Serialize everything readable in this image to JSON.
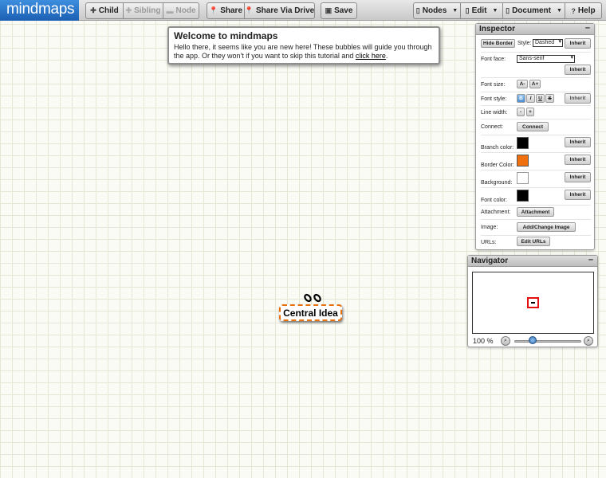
{
  "app": {
    "logo": "mindmaps"
  },
  "toolbar": {
    "child": "Child",
    "sibling": "Sibling",
    "node": "Node",
    "share": "Share",
    "share_drive": "Share Via Drive",
    "save": "Save",
    "nodes": "Nodes",
    "edit": "Edit",
    "document": "Document",
    "help": "Help"
  },
  "welcome": {
    "title": "Welcome to mindmaps",
    "text": "Hello there, it seems like you are new here! These bubbles will guide you through the app. Or they won't if you want to skip this tutorial and",
    "link": "click here",
    "end": "."
  },
  "inspector": {
    "title": "Inspector",
    "collapse": "–",
    "hide_border": "Hide Border",
    "style_label": "Style:",
    "style_value": "Dashed",
    "inherit": "Inherit",
    "font_face_label": "Font face:",
    "font_face_value": "Sans-serif",
    "font_size_label": "Font size:",
    "font_size_down": "A-",
    "font_size_up": "A+",
    "font_style_label": "Font style:",
    "bold": "B",
    "italic": "I",
    "underline": "U",
    "strike": "S",
    "line_width_label": "Line width:",
    "minus": "-",
    "plus": "+",
    "connect_label": "Connect:",
    "connect_btn": "Connect",
    "branch_color_label": "Branch color:",
    "border_color_label": "Border Color:",
    "background_label": "Background:",
    "font_color_label": "Font color:",
    "attachment_label": "Attachment:",
    "attachment_btn": "Attachment",
    "image_label": "Image:",
    "image_btn": "Add/Change Image",
    "urls_label": "URLs:",
    "urls_btn": "Edit URLs",
    "colors": {
      "branch": "#000000",
      "border": "#f07010",
      "background": "#ffffff",
      "font": "#000000"
    }
  },
  "navigator": {
    "title": "Navigator",
    "collapse": "–",
    "zoom": "100 %",
    "zoom_position": 0.27
  },
  "canvas": {
    "central_node": "Central Idea"
  }
}
